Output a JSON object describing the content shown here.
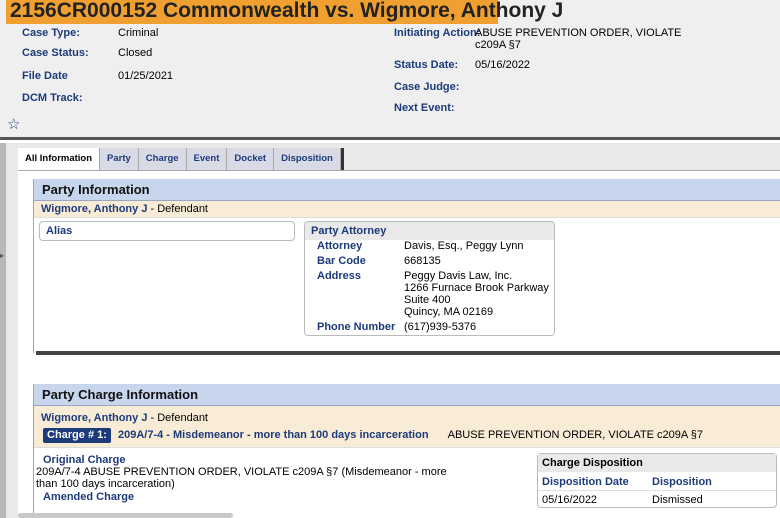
{
  "case": {
    "title": "2156CR000152 Commonwealth vs. Wigmore, Anthony J",
    "fields": {
      "case_type_label": "Case Type:",
      "case_type": "Criminal",
      "case_status_label": "Case Status:",
      "case_status": "Closed",
      "file_date_label": "File Date",
      "file_date": "01/25/2021",
      "dcm_track_label": "DCM Track:",
      "initiating_action_label": "Initiating Action:",
      "initiating_action_line1": "ABUSE PREVENTION ORDER, VIOLATE",
      "initiating_action_line2": "c209A §7",
      "status_date_label": "Status Date:",
      "status_date": "05/16/2022",
      "case_judge_label": "Case Judge:",
      "next_event_label": "Next Event:"
    },
    "favorite_icon": "☆"
  },
  "tabs": [
    "All Information",
    "Party",
    "Charge",
    "Event",
    "Docket",
    "Disposition"
  ],
  "party_info": {
    "heading": "Party Information",
    "party_name": "Wigmore, Anthony J",
    "party_role": " - Defendant",
    "alias_label": "Alias",
    "attorney_box_title": "Party Attorney",
    "attorney_label": "Attorney",
    "attorney": "Davis, Esq., Peggy Lynn",
    "bar_code_label": "Bar Code",
    "bar_code": "668135",
    "address_label": "Address",
    "address_lines": [
      "Peggy Davis Law, Inc.",
      "1266 Furnace Brook Parkway",
      "Suite 400",
      "Quincy, MA  02169"
    ],
    "phone_label": "Phone Number",
    "phone": "(617)939-5376"
  },
  "charge_info": {
    "heading": "Party Charge Information",
    "party_name": "Wigmore, Anthony J",
    "party_role": " - Defendant",
    "charge_pill": "Charge # 1:",
    "charge_code": "209A/7-4 - Misdemeanor - more than 100 days incarceration",
    "charge_desc": "ABUSE PREVENTION ORDER, VIOLATE c209A §7",
    "original_charge_label": "Original Charge",
    "original_charge_line1": "209A/7-4 ABUSE PREVENTION ORDER, VIOLATE c209A §7 (Misdemeanor - more",
    "original_charge_line2": "than 100 days incarceration)",
    "amended_charge_label": "Amended Charge",
    "disposition_box_title": "Charge Disposition",
    "disp_date_col": "Disposition Date",
    "disp_col": "Disposition",
    "disp_date": "05/16/2022",
    "disposition": "Dismissed"
  }
}
